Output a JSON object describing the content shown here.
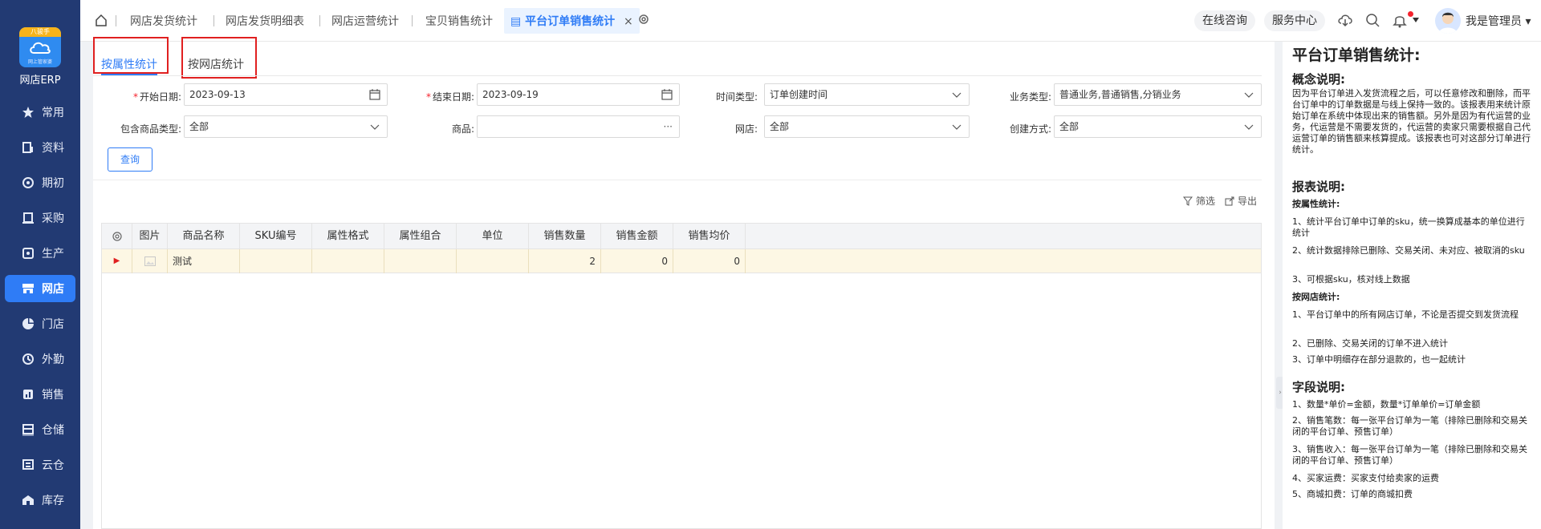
{
  "sidebar": {
    "logo_badge": "八骏手",
    "logo_sub": "网上管家婆",
    "logo_name": "网店ERP",
    "items": [
      {
        "label": "常用",
        "icon": "star-icon"
      },
      {
        "label": "资料",
        "icon": "document-icon"
      },
      {
        "label": "期初",
        "icon": "target-icon"
      },
      {
        "label": "采购",
        "icon": "purchase-icon"
      },
      {
        "label": "生产",
        "icon": "factory-icon"
      },
      {
        "label": "网店",
        "icon": "store-icon",
        "active": true
      },
      {
        "label": "门店",
        "icon": "pie-icon"
      },
      {
        "label": "外勤",
        "icon": "field-icon"
      },
      {
        "label": "销售",
        "icon": "chart-bar-icon"
      },
      {
        "label": "仓储",
        "icon": "warehouse-icon"
      },
      {
        "label": "云仓",
        "icon": "cloud-warehouse-icon"
      },
      {
        "label": "库存",
        "icon": "inventory-icon"
      }
    ]
  },
  "topbar": {
    "tabs": [
      "网店发货统计",
      "网店发货明细表",
      "网店运营统计",
      "宝贝销售统计"
    ],
    "active_tab": "平台订单销售统计",
    "close_glyph": "×",
    "online_consult": "在线咨询",
    "service_center": "服务中心",
    "user_name": "我是管理员"
  },
  "subtabs": {
    "by_attribute": "按属性统计",
    "by_store": "按网店统计"
  },
  "filters": {
    "start_date_label": "开始日期:",
    "start_date": "2023-09-13",
    "end_date_label": "结束日期:",
    "end_date": "2023-09-19",
    "time_type_label": "时间类型:",
    "time_type": "订单创建时间",
    "biz_type_label": "业务类型:",
    "biz_type": "普通业务,普通销售,分销业务",
    "goods_type_label": "包含商品类型:",
    "goods_type": "全部",
    "goods_label": "商品:",
    "goods": "",
    "goods_more": "···",
    "store_label": "网店:",
    "store": "全部",
    "create_mode_label": "创建方式:",
    "create_mode": "全部",
    "query_button": "查询"
  },
  "toolbar": {
    "filter": "筛选",
    "export": "导出"
  },
  "table": {
    "columns": [
      "图片",
      "商品名称",
      "SKU编号",
      "属性格式",
      "属性组合",
      "单位",
      "销售数量",
      "销售金额",
      "销售均价"
    ],
    "rows": [
      {
        "name": "测试",
        "sku": "",
        "attr_format": "",
        "attr_combo": "",
        "unit": "",
        "qty": "2",
        "amount": "0",
        "avg_price": "0"
      }
    ]
  },
  "info_panel": {
    "title": "平台订单销售统计:",
    "concept_heading": "概念说明:",
    "concept_text": "因为平台订单进入发货流程之后，可以任意修改和删除，而平台订单中的订单数据是与线上保持一致的。该报表用来统计原始订单在系统中体现出来的销售额。另外是因为有代运营的业务，代运营是不需要发货的，代运营的卖家只需要根据自己代运营订单的销售额来核算提成。该报表也可对这部分订单进行统计。",
    "report_heading": "报表说明:",
    "by_attr_title": "按属性统计:",
    "by_attr_items": [
      "1、统计平台订单中订单的sku，统一换算成基本的单位进行统计",
      "2、统计数据排除已删除、交易关闭、未对应、被取消的sku",
      "3、可根据sku，核对线上数据"
    ],
    "by_store_title": "按网店统计:",
    "by_store_items": [
      "1、平台订单中的所有网店订单，不论是否提交到发货流程",
      "2、已删除、交易关闭的订单不进入统计",
      "3、订单中明细存在部分退款的，也一起统计"
    ],
    "field_heading": "字段说明:",
    "field_items": [
      "1、数量*单价=金额，数量*订单单价=订单金额",
      "2、销售笔数：每一张平台订单为一笔（排除已删除和交易关闭的平台订单、预售订单）",
      "3、销售收入：每一张平台订单为一笔（排除已删除和交易关闭的平台订单、预售订单）",
      "4、买家运费：买家支付给卖家的运费",
      "5、商城扣费：订单的商城扣费"
    ]
  },
  "colors": {
    "sidebar_bg": "#223a73",
    "accent": "#2f7cf6",
    "highlight_border": "#e02020",
    "selected_row": "#fdf7e4"
  }
}
